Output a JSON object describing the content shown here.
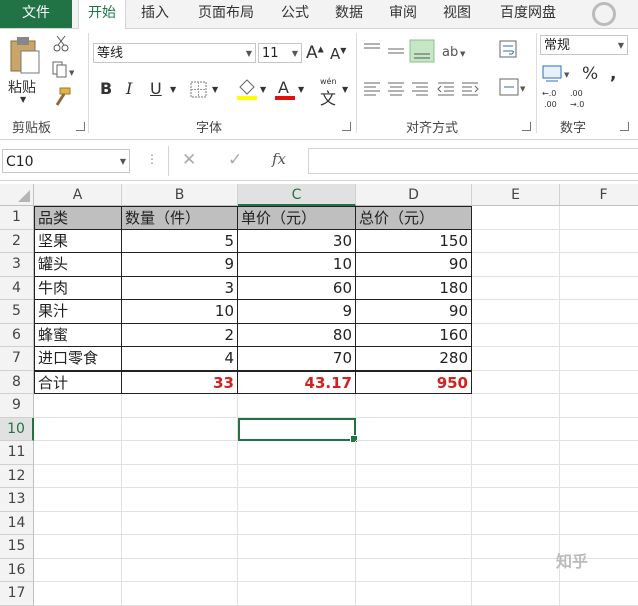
{
  "tabs": [
    "文件",
    "开始",
    "插入",
    "页面布局",
    "公式",
    "数据",
    "审阅",
    "视图",
    "百度网盘"
  ],
  "ribbon": {
    "paste_label": "粘贴",
    "font_name": "等线",
    "font_size": "11",
    "number_format": "常规",
    "phonetic_label": "wén",
    "groups": {
      "clipboard": "剪贴板",
      "font": "字体",
      "alignment": "对齐方式",
      "number": "数字"
    }
  },
  "formula_bar": {
    "name_box": "C10",
    "fx": "fx",
    "content": ""
  },
  "columns": [
    "A",
    "B",
    "C",
    "D",
    "E",
    "F"
  ],
  "rows": [
    "1",
    "2",
    "3",
    "4",
    "5",
    "6",
    "7",
    "8",
    "9",
    "10",
    "11",
    "12",
    "13",
    "14",
    "15",
    "16",
    "17"
  ],
  "table": {
    "headers": [
      "品类",
      "数量（件）",
      "单价（元）",
      "总价（元）"
    ],
    "rows": [
      [
        "坚果",
        "5",
        "30",
        "150"
      ],
      [
        "罐头",
        "9",
        "10",
        "90"
      ],
      [
        "牛肉",
        "3",
        "60",
        "180"
      ],
      [
        "果汁",
        "10",
        "9",
        "90"
      ],
      [
        "蜂蜜",
        "2",
        "80",
        "160"
      ],
      [
        "进口零食",
        "4",
        "70",
        "280"
      ]
    ],
    "total": [
      "合计",
      "33",
      "43.17",
      "950"
    ]
  },
  "watermark": "知乎",
  "colors": {
    "accent": "#217346",
    "header_fill": "#bfbfbf",
    "total_text": "#d32020"
  }
}
